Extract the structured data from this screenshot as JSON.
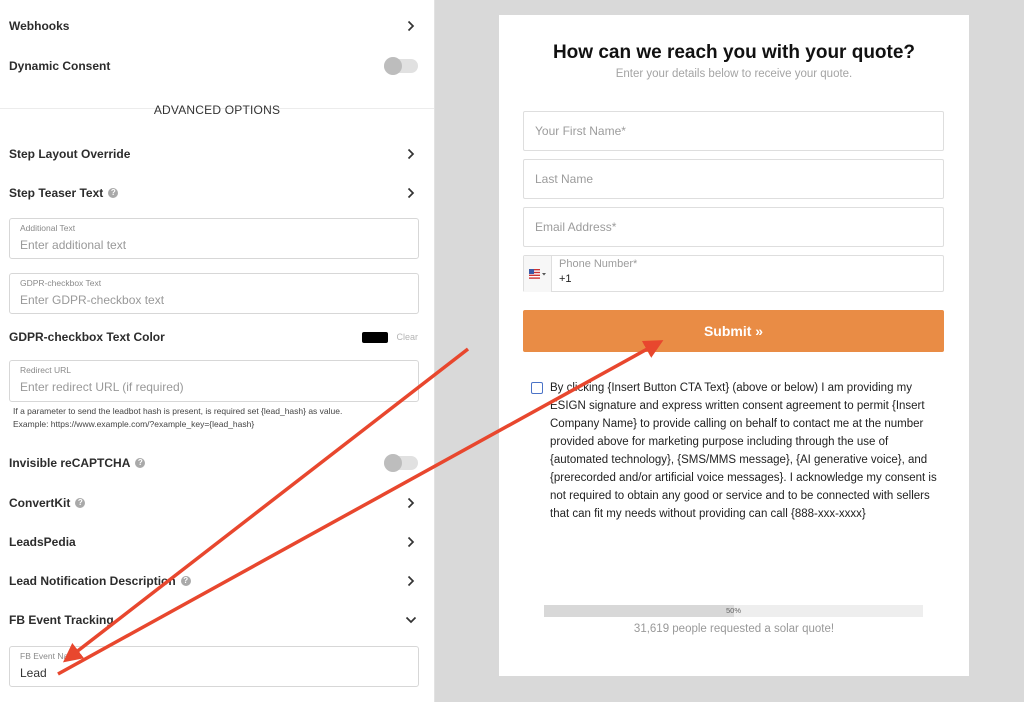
{
  "settings": {
    "webhooks": "Webhooks",
    "dynamic_consent": "Dynamic Consent",
    "advanced_options": "ADVANCED OPTIONS",
    "step_layout_override": "Step Layout Override",
    "step_teaser_text": "Step Teaser Text",
    "additional_text": {
      "label": "Additional Text",
      "placeholder": "Enter additional text"
    },
    "gdpr_text": {
      "label": "GDPR-checkbox Text",
      "placeholder": "Enter GDPR-checkbox text"
    },
    "gdpr_color": {
      "label": "GDPR-checkbox Text Color",
      "color": "#000000",
      "clear": "Clear"
    },
    "redirect_url": {
      "label": "Redirect URL",
      "placeholder": "Enter redirect URL (if required)"
    },
    "redirect_hint_1": "If a parameter to send the leadbot hash is present, is required set {lead_hash} as value.",
    "redirect_hint_2": "Example: https://www.example.com/?example_key={lead_hash}",
    "invisible_recaptcha": "Invisible reCAPTCHA",
    "convertkit": "ConvertKit",
    "leadspedia": "LeadsPedia",
    "lead_notification_description": "Lead Notification Description",
    "fb_event_tracking": "FB Event Tracking",
    "fb_event_name": {
      "label": "FB Event Name",
      "value": "Lead"
    }
  },
  "preview": {
    "title": "How can we reach you with your quote?",
    "subtitle": "Enter your details below to receive your quote.",
    "first_name": "Your First Name*",
    "last_name": "Last Name",
    "email": "Email Address*",
    "phone_label": "Phone Number*",
    "phone_value": "+1",
    "submit": "Submit »",
    "consent": "By clicking {Insert Button CTA Text} (above or below) I am providing my ESIGN signature and express written consent agreement to permit {Insert Company Name} to provide calling on behalf to contact me at the number provided above for marketing purpose including through the use of {automated technology}, {SMS/MMS message}, {AI generative voice}, and {prerecorded and/or artificial voice messages}. I acknowledge my consent is not required to obtain any good or service and to be connected with sellers that can fit my needs without providing can call {888-xxx-xxxx}",
    "progress_label": "50%",
    "progress_value": 0.5,
    "social_proof": "31,619 people requested a solar quote!"
  },
  "colors": {
    "submit": "#e98c45",
    "annotation_arrow": "#e8472e"
  }
}
